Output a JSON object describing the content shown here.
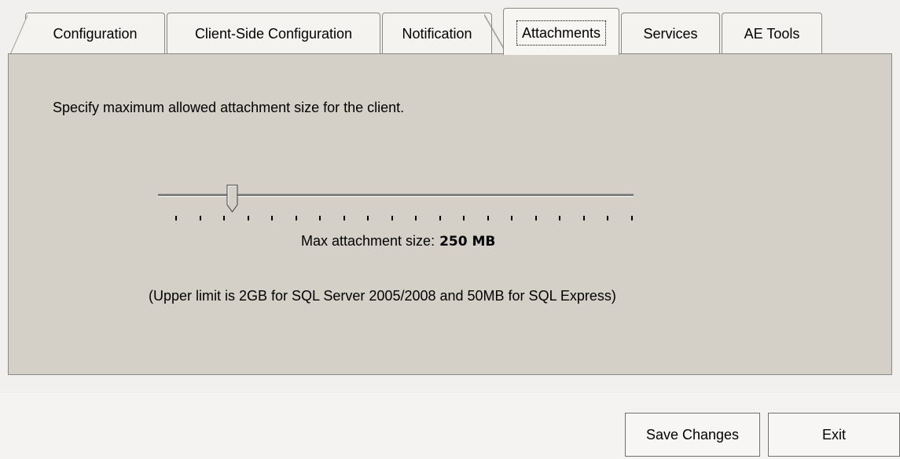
{
  "tabs": [
    {
      "label": "Configuration"
    },
    {
      "label": "Client-Side Configuration"
    },
    {
      "label": "Notification"
    },
    {
      "label": "Attachments",
      "selected": true
    },
    {
      "label": "Services"
    },
    {
      "label": "AE Tools"
    }
  ],
  "panel": {
    "description": "Specify maximum allowed attachment size for the client.",
    "slider": {
      "value_fraction": 0.125,
      "tick_count": 20
    },
    "size_label": "Max attachment size:",
    "size_value": "250 MB",
    "limit_note": "(Upper limit is 2GB for SQL Server 2005/2008 and 50MB for SQL Express)"
  },
  "footer": {
    "save_label": "Save Changes",
    "exit_label": "Exit"
  },
  "icons": {
    "slider_thumb": "slider-thumb-pointer"
  },
  "colors": {
    "panel_bg": "#d4d0c8",
    "window_bg": "#f1f0ee"
  }
}
